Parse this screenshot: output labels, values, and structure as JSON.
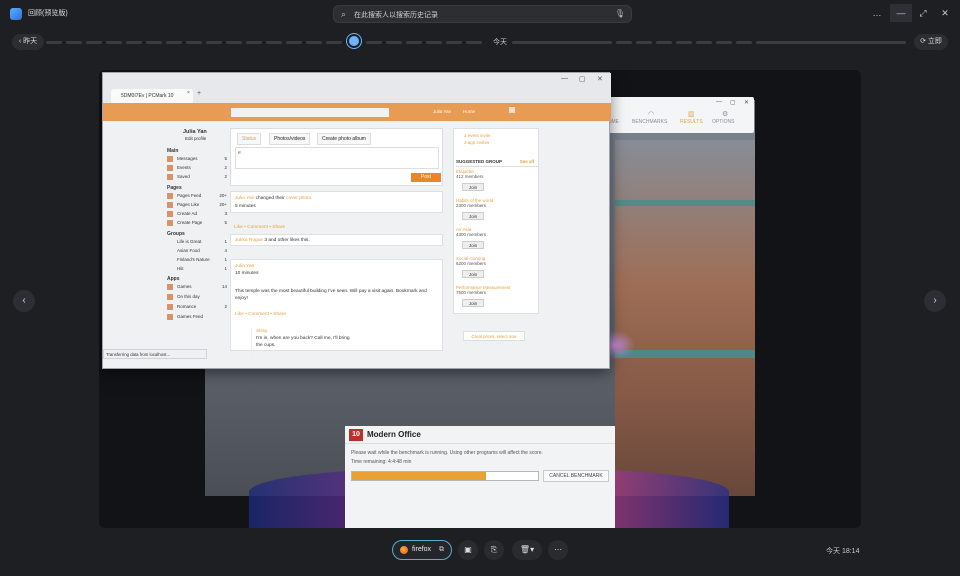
{
  "titlebar": {
    "app_title": "回顾(预览版)",
    "search_placeholder": "在此搜索人以搜索历史记录",
    "controls": [
      "…",
      "—",
      "⤢",
      "✕"
    ]
  },
  "timeline": {
    "back_label": "‹ 昨天",
    "today_label": "今天",
    "now_label": "⟳ 立即"
  },
  "firefox": {
    "tab_title": "5DM0I7Ev | PCMark 10",
    "tab_close": "×",
    "new_tab": "+",
    "window_controls": [
      "—",
      "▢",
      "✕"
    ],
    "facebook": {
      "user_label": "Julia Yan",
      "home_label": "Home",
      "profile_name": "Julia Yan",
      "edit_profile": "Edit profile",
      "sections": [
        {
          "title": "Main",
          "items": [
            {
              "label": "Messages",
              "count": "5"
            },
            {
              "label": "Events",
              "count": "2"
            },
            {
              "label": "Saved",
              "count": "2"
            }
          ]
        },
        {
          "title": "Pages",
          "items": [
            {
              "label": "Pages Feed",
              "count": "20+"
            },
            {
              "label": "Pages Like",
              "count": "20+"
            },
            {
              "label": "Create Ad",
              "count": "3"
            },
            {
              "label": "Create Page",
              "count": "5"
            }
          ]
        },
        {
          "title": "Groups",
          "subitems": [
            {
              "label": "Life is Great",
              "count": "1"
            },
            {
              "label": "Asian Food",
              "count": "4"
            },
            {
              "label": "Finland's Nature",
              "count": "1"
            },
            {
              "label": "Hiit",
              "count": "1"
            }
          ]
        },
        {
          "title": "Apps",
          "items": [
            {
              "label": "Games",
              "count": "14"
            },
            {
              "label": "On this day",
              "count": ""
            },
            {
              "label": "Romance",
              "count": "2"
            },
            {
              "label": "Games Feed",
              "count": ""
            }
          ]
        }
      ],
      "composer": {
        "tabs": [
          "Status",
          "Photos/videos",
          "Create photo album"
        ],
        "text": "e",
        "post_button": "Post"
      },
      "posts": [
        {
          "author": "Julia Yan",
          "action_pre": " changed their ",
          "action_link": "cover photo.",
          "time": "5 minutes",
          "actions": "Like • Comment • Share",
          "likes_author": "Jukka Rogue",
          "likes_rest": " 3 and other likes this."
        },
        {
          "author": "Julia Yan",
          "time": "10 minutes",
          "body": "This temple was the most beautiful building I've seen. Will pay a visit again. Bookmark and enjoy!",
          "actions": "Like • Comment • Share",
          "reply_author": "Sissy",
          "reply_body": "I'm in, when are you back? Call me, I'll bring the cups."
        }
      ],
      "right": {
        "requests": [
          "1 event invite",
          "3 app invites"
        ],
        "suggested": "SUGGESTED GROUP",
        "see_all": "See all",
        "groups": [
          {
            "name": "Etiquette",
            "members": "412 members",
            "join": "Join"
          },
          {
            "name": "Habits of the world",
            "members": "2300 members",
            "join": "Join"
          },
          {
            "name": "Air Asia",
            "members": "4300 members",
            "join": "Join"
          },
          {
            "name": "Social Gaming",
            "members": "6200 members",
            "join": "Join"
          },
          {
            "name": "Performance Measurement",
            "members": "7500 members",
            "join": "Join"
          }
        ],
        "ad": "Great prices, select now"
      }
    },
    "status_text": "Transferring data from localhost..."
  },
  "benchmark_window": {
    "nav": [
      "HOME",
      "BENCHMARKS",
      "RESULTS",
      "OPTIONS"
    ],
    "controls": [
      "—",
      "▢",
      "✕"
    ]
  },
  "modern_office": {
    "logo": "10",
    "title": "Modern Office",
    "message": "Please wait while the benchmark is running. Using other programs will affect the score.",
    "remaining": "Time remaining: 4:4:48 min",
    "progress": 0.72,
    "cancel": "CANCEL BENCHMARK"
  },
  "bottom": {
    "app_label": "firefox",
    "time": "今天 18:14"
  },
  "colors": {
    "accent": "#6cb4ff",
    "fb_orange": "#e89b52",
    "progress": "#e8a233"
  }
}
